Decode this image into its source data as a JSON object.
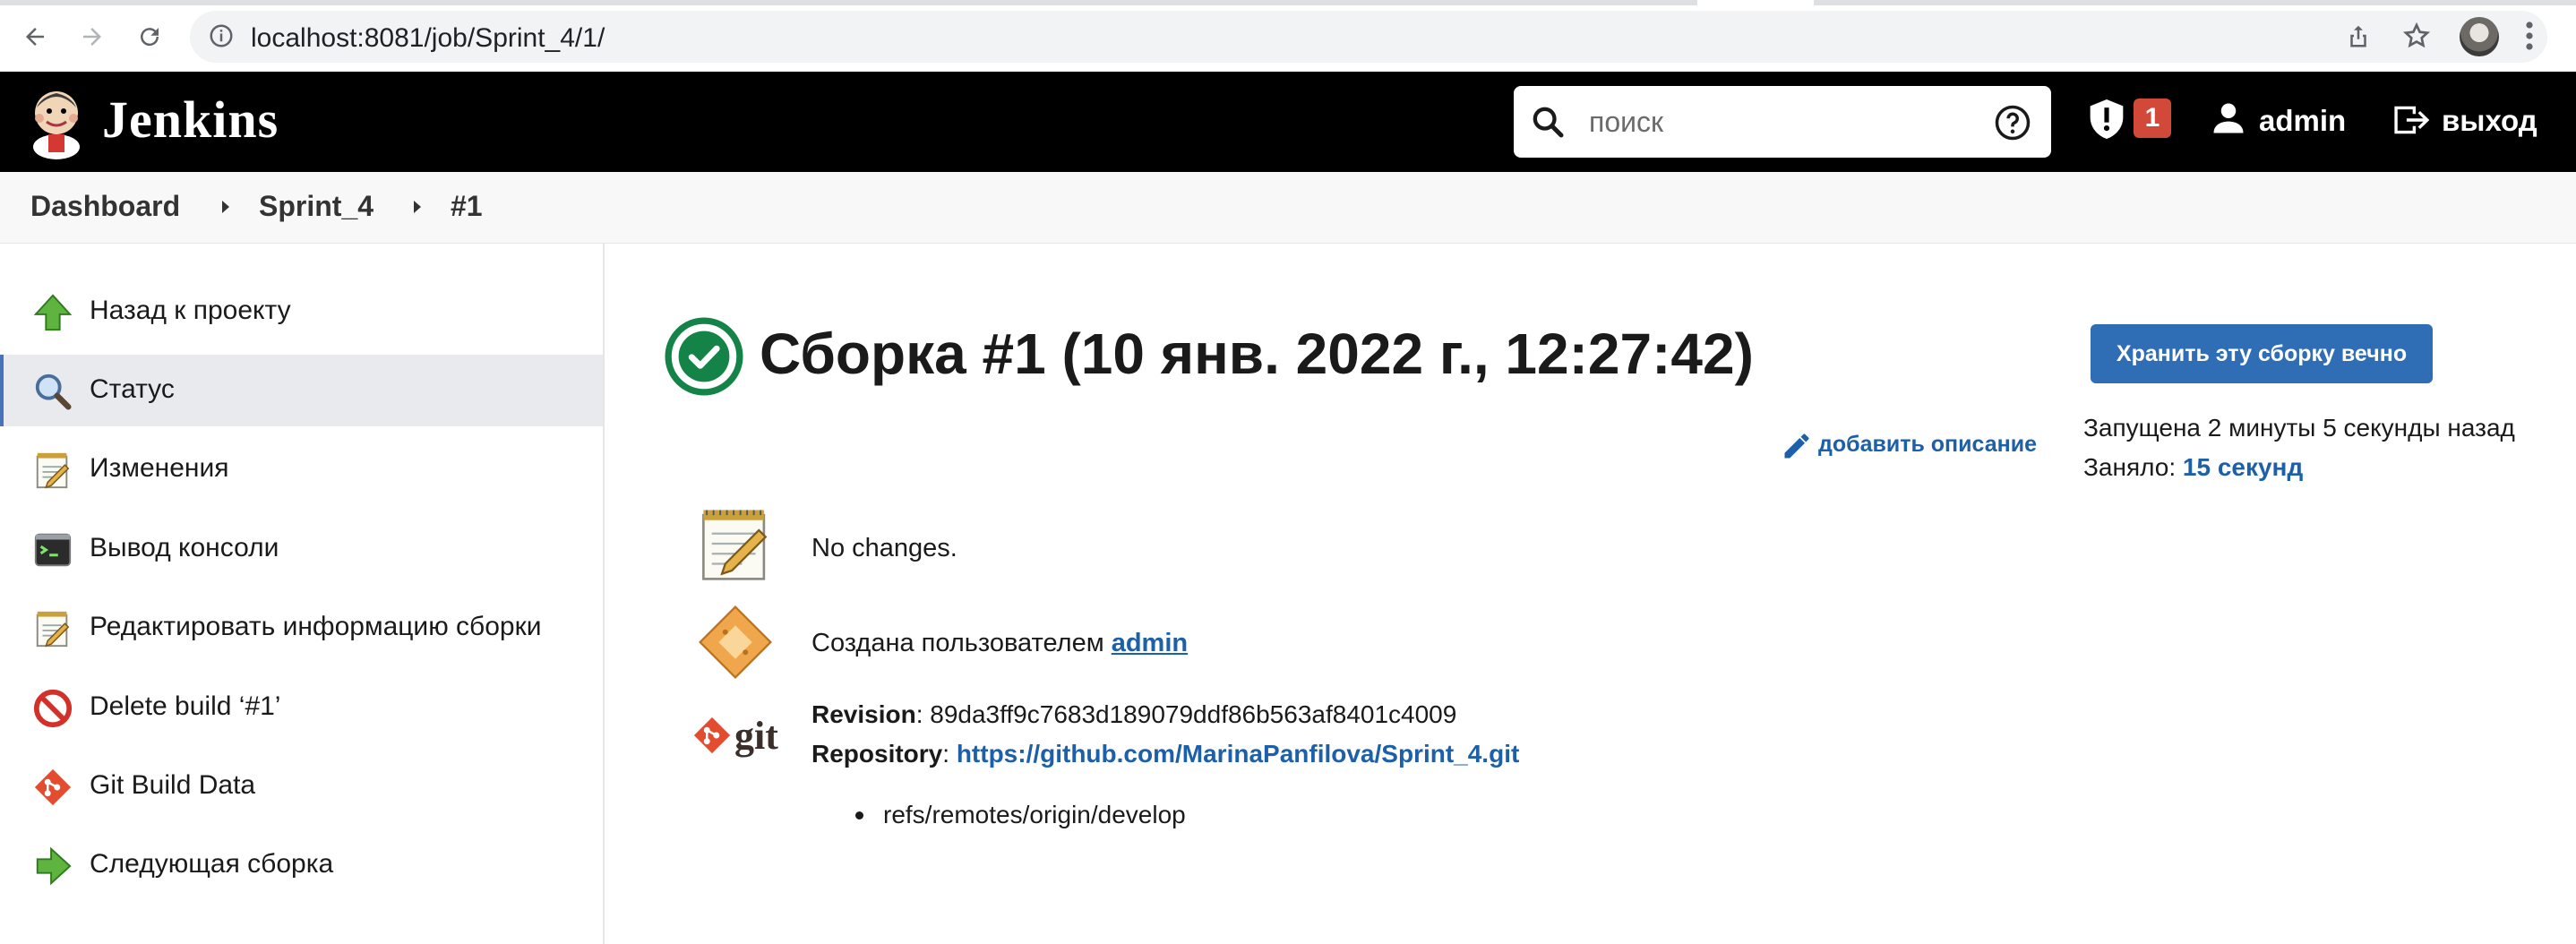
{
  "browser": {
    "url": "localhost:8081/job/Sprint_4/1/"
  },
  "header": {
    "app_title": "Jenkins",
    "search_placeholder": "поиск",
    "security_count": "1",
    "user": "admin",
    "logout_label": "выход"
  },
  "breadcrumb": [
    "Dashboard",
    "Sprint_4",
    "#1"
  ],
  "sidebar": {
    "items": [
      {
        "label": "Назад к проекту",
        "icon": "up-arrow-icon"
      },
      {
        "label": "Статус",
        "icon": "magnifier-icon"
      },
      {
        "label": "Изменения",
        "icon": "notepad-icon"
      },
      {
        "label": "Вывод консоли",
        "icon": "terminal-icon"
      },
      {
        "label": "Редактировать информацию сборки",
        "icon": "notepad-edit-icon"
      },
      {
        "label": "Delete build ‘#1’",
        "icon": "no-entry-icon"
      },
      {
        "label": "Git Build Data",
        "icon": "git-icon"
      },
      {
        "label": "Следующая сборка",
        "icon": "next-arrow-icon"
      }
    ],
    "active_index": 1
  },
  "main": {
    "title": "Сборка #1 (10 янв. 2022 г., 12:27:42)",
    "keep_button": "Хранить эту сборку вечно",
    "started": "Запущена 2 минуты 5 секунды назад",
    "took_prefix": "Заняло: ",
    "took_value": "15 секунд",
    "add_description": "добавить описание",
    "changes": "No changes.",
    "created_by_prefix": "Создана пользователем ",
    "created_by_user": "admin",
    "git_label": "git",
    "revision_label": "Revision",
    "revision_value": ": 89da3ff9c7683d189079ddf86b563af8401c4009",
    "repository_label": "Repository",
    "repository_sep": ": ",
    "repository_url": "https://github.com/MarinaPanfilova/Sprint_4.git",
    "branch": "refs/remotes/origin/develop"
  },
  "colors": {
    "header_bg": "#000000",
    "accent_blue": "#2f6db5",
    "link_blue": "#1d5fa8",
    "success_green": "#138347",
    "badge_red": "#d24939"
  }
}
